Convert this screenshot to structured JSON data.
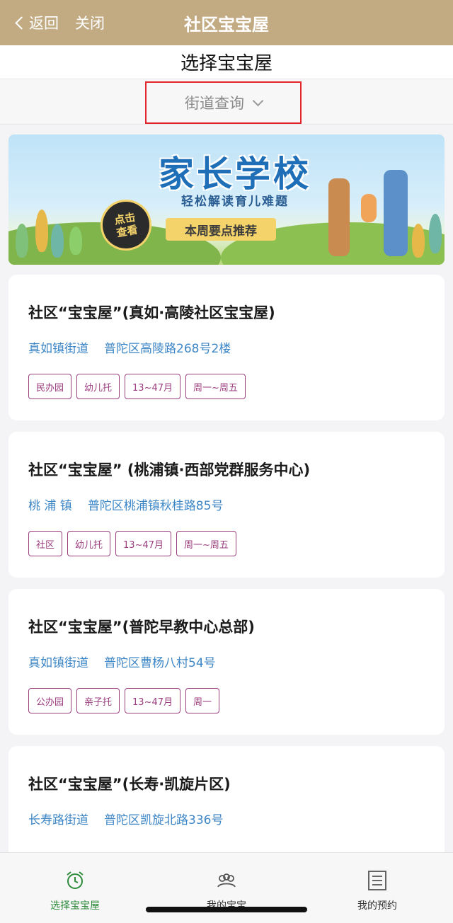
{
  "nav": {
    "back_label": "返回",
    "close_label": "关闭",
    "title": "社区宝宝屋"
  },
  "page": {
    "title": "选择宝宝屋"
  },
  "filter": {
    "street_query_label": "街道查询"
  },
  "banner": {
    "title": "家长学校",
    "subtitle": "轻松解读育儿难题",
    "tag": "本周要点推荐",
    "badge_line1": "点击",
    "badge_line2": "查看"
  },
  "cards": [
    {
      "title": "社区“宝宝屋”(真如·高陵社区宝宝屋)",
      "street": "真如镇街道",
      "address": "普陀区高陵路268号2楼",
      "tags": [
        "民办园",
        "幼儿托",
        "13~47月",
        "周一~周五"
      ]
    },
    {
      "title": "社区“宝宝屋” (桃浦镇·西部党群服务中心)",
      "street": "桃 浦 镇",
      "address": "普陀区桃浦镇秋桂路85号",
      "tags": [
        "社区",
        "幼儿托",
        "13~47月",
        "周一~周五"
      ]
    },
    {
      "title": "社区“宝宝屋”(普陀早教中心总部)",
      "street": "真如镇街道",
      "address": "普陀区曹杨八村54号",
      "tags": [
        "公办园",
        "亲子托",
        "13~47月",
        "周一"
      ]
    },
    {
      "title": "社区“宝宝屋”(长寿·凯旋片区)",
      "street": "长寿路街道",
      "address": "普陀区凯旋北路336号",
      "tags": []
    }
  ],
  "tabbar": {
    "items": [
      {
        "label": "选择宝宝屋",
        "icon": "alarm-clock-icon",
        "active": true
      },
      {
        "label": "我的宝宝",
        "icon": "babies-icon",
        "active": false
      },
      {
        "label": "我的预约",
        "icon": "list-icon",
        "active": false
      }
    ]
  },
  "colors": {
    "nav_bg": "#c2ab83",
    "accent_link": "#3d86c6",
    "tag_border": "#9b3d7f",
    "highlight_border": "#e0262b",
    "active_tab": "#2e8b3a"
  }
}
